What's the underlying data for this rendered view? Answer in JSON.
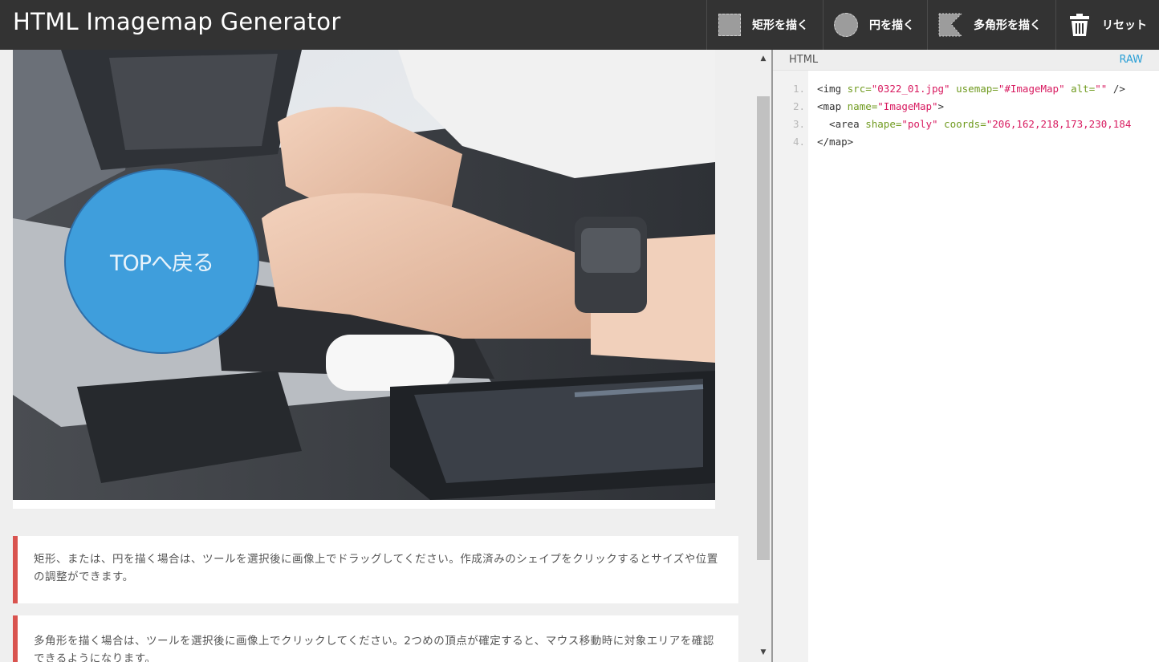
{
  "app": {
    "title": "HTML Imagemap Generator"
  },
  "toolbar": {
    "rect_label": "矩形を描く",
    "circle_label": "円を描く",
    "poly_label": "多角形を描く",
    "reset_label": "リセット"
  },
  "canvas": {
    "circle_label": "TOPへ戻る"
  },
  "notes": [
    "矩形、または、円を描く場合は、ツールを選択後に画像上でドラッグしてください。作成済みのシェイプをクリックするとサイズや位置の調整ができます。",
    "多角形を描く場合は、ツールを選択後に画像上でクリックしてください。2つめの頂点が確定すると、マウス移動時に対象エリアを確認できるようになります。"
  ],
  "code_panel": {
    "language": "HTML",
    "raw_label": "RAW",
    "line_numbers": [
      "1",
      "2",
      "3",
      "4"
    ],
    "line1": {
      "open": "<img ",
      "attr_src": "src=",
      "val_src": "\"0322_01.jpg\"",
      "attr_usemap": " usemap=",
      "val_usemap": "\"#ImageMap\"",
      "attr_alt": " alt=",
      "val_alt": "\"\"",
      "close": " />"
    },
    "line2": {
      "open": "<map ",
      "attr_name": "name=",
      "val_name": "\"ImageMap\"",
      "close": ">"
    },
    "line3": {
      "open": "  <area ",
      "attr_shape": "shape=",
      "val_shape": "\"poly\"",
      "attr_coords": " coords=",
      "val_coords": "\"206,162,218,173,230,184"
    },
    "line4": "</map>"
  },
  "colors": {
    "topbar": "#333333",
    "circle_fill": "#3f9edc",
    "note_accent": "#d9534f",
    "raw_link": "#2a9fd6",
    "code_attr": "#6f9a1e",
    "code_string": "#d81b60"
  },
  "icons": {
    "rect_tool": "dashed-square-icon",
    "circle_tool": "dashed-circle-icon",
    "poly_tool": "dashed-polygon-icon",
    "reset": "trash-icon",
    "scroll_up": "triangle-up-icon",
    "scroll_down": "triangle-down-icon"
  }
}
